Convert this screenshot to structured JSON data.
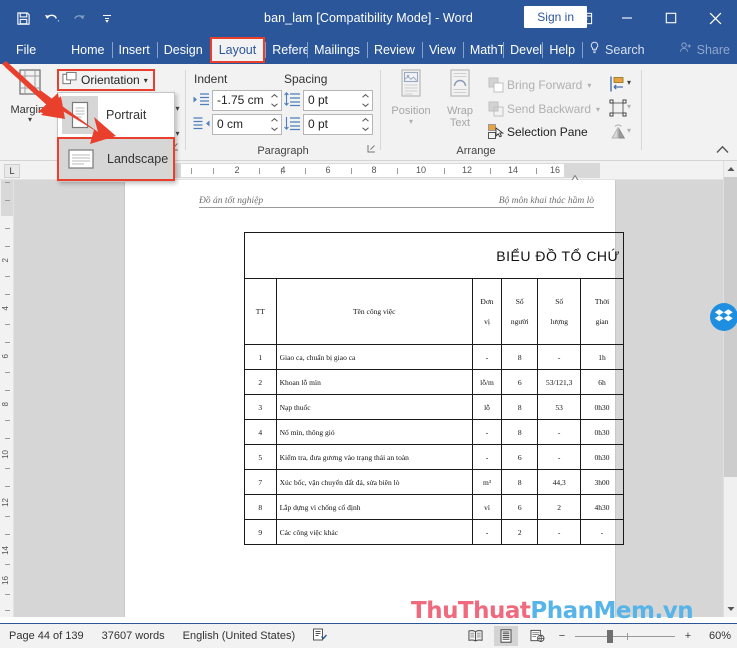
{
  "titlebar": {
    "document_name": "ban_lam [Compatibility Mode]  -  Word",
    "signin_label": "Sign in",
    "qat": [
      {
        "name": "save-icon",
        "tooltip": "Save"
      },
      {
        "name": "undo-icon",
        "tooltip": "Undo"
      },
      {
        "name": "redo-icon",
        "tooltip": "Redo"
      },
      {
        "name": "customize-qat-icon",
        "tooltip": "Customize Quick Access Toolbar"
      }
    ],
    "window_buttons": [
      {
        "name": "ribbon-display-options-icon",
        "glyph": "ribbon"
      },
      {
        "name": "minimize-button",
        "glyph": "minimize"
      },
      {
        "name": "maximize-button",
        "glyph": "maximize"
      },
      {
        "name": "close-button",
        "glyph": "close"
      }
    ]
  },
  "tabs": [
    {
      "label": "File",
      "active": false
    },
    {
      "label": "Home",
      "active": false
    },
    {
      "label": "Insert",
      "active": false
    },
    {
      "label": "Design",
      "active": false
    },
    {
      "label": "Layout",
      "active": true
    },
    {
      "label": "Referenc",
      "active": false
    },
    {
      "label": "Mailings",
      "active": false
    },
    {
      "label": "Review",
      "active": false
    },
    {
      "label": "View",
      "active": false
    },
    {
      "label": "MathTyp",
      "active": false
    },
    {
      "label": "Develop",
      "active": false
    },
    {
      "label": "Help",
      "active": false
    }
  ],
  "tab_extras": {
    "search_label": "Search",
    "share_label": "Share"
  },
  "ribbon": {
    "page_setup": {
      "margins_label": "Margins",
      "orientation_label": "Orientation",
      "group_label": "",
      "dropdown": {
        "open": true,
        "items": [
          {
            "label": "Portrait",
            "selected": false
          },
          {
            "label": "Landscape",
            "selected": true
          }
        ]
      }
    },
    "paragraph": {
      "group_label": "Paragraph",
      "indent_label": "Indent",
      "spacing_label": "Spacing",
      "indent_left_value": "-1.75 cm",
      "indent_right_value": "0 cm",
      "spacing_before_value": "0 pt",
      "spacing_after_value": "0 pt"
    },
    "arrange": {
      "group_label": "Arrange",
      "position_label": "Position",
      "wrap_text_label": "Wrap Text",
      "bring_forward_label": "Bring Forward",
      "send_backward_label": "Send Backward",
      "selection_pane_label": "Selection Pane",
      "align_label": "Align",
      "group_objects_label": "Group",
      "rotate_label": "Rotate"
    }
  },
  "ruler": {
    "horizontal_numbers": [
      "2",
      "4",
      "6",
      "8",
      "10",
      "12",
      "14",
      "16"
    ],
    "vertical_numbers": [
      "2",
      "4",
      "6",
      "8",
      "10",
      "12",
      "14",
      "16"
    ],
    "tab_stop_selector": "L"
  },
  "document": {
    "header_left": "Đồ án tốt nghiệp",
    "header_right": "Bộ môn khai thác hầm lò",
    "table_title": "BIỂU ĐỒ TỔ CHỨ",
    "columns": [
      "TT",
      "Tên công việc",
      "Đơn vị",
      "Số người",
      "Số lượng",
      "Thời gian"
    ],
    "column_lines": {
      "tt": "TT",
      "name": "Tên công việc",
      "donvi_top": "Đơn",
      "donvi_bot": "vị",
      "songuoi_top": "Số",
      "songuoi_bot": "người",
      "soluong_top": "Số",
      "soluong_bot": "lượng",
      "thoigian_top": "Thời",
      "thoigian_bot": "gian"
    },
    "rows": [
      {
        "tt": "1",
        "name": "Giao ca, chuẩn bị giao ca",
        "donvi": "-",
        "songuoi": "8",
        "soluong": "-",
        "thoigian": "1h"
      },
      {
        "tt": "2",
        "name": "Khoan lỗ mìn",
        "donvi": "lỗ/m",
        "songuoi": "6",
        "soluong": "53/121,3",
        "thoigian": "6h"
      },
      {
        "tt": "3",
        "name": "Nạp thuốc",
        "donvi": "lỗ",
        "songuoi": "8",
        "soluong": "53",
        "thoigian": "0h30"
      },
      {
        "tt": "4",
        "name": "Nổ mìn, thông gió",
        "donvi": "-",
        "songuoi": "8",
        "soluong": "-",
        "thoigian": "0h30"
      },
      {
        "tt": "5",
        "name": "Kiểm tra, đưa gương vào trạng thái an toàn",
        "donvi": "-",
        "songuoi": "6",
        "soluong": "-",
        "thoigian": "0h30"
      },
      {
        "tt": "7",
        "name": "Xúc bốc, vận chuyển đất đá, sửa biên lò",
        "donvi": "m³",
        "songuoi": "8",
        "soluong": "44,3",
        "thoigian": "3h00"
      },
      {
        "tt": "8",
        "name": "Lắp dựng vì chống cố định",
        "donvi": "vì",
        "songuoi": "6",
        "soluong": "2",
        "thoigian": "4h30"
      },
      {
        "tt": "9",
        "name": "Các công việc khác",
        "donvi": "-",
        "songuoi": "2",
        "soluong": "-",
        "thoigian": "-"
      }
    ]
  },
  "watermark": {
    "part1": "ThuThuat",
    "part2": "PhanMem.vn"
  },
  "statusbar": {
    "page_info": "Page 44 of 139",
    "word_count": "37607 words",
    "language": "English (United States)",
    "proofing_icon": "proofing-errors-icon",
    "views": [
      {
        "name": "read-mode-view-button",
        "active": false
      },
      {
        "name": "print-layout-view-button",
        "active": true
      },
      {
        "name": "web-layout-view-button",
        "active": false
      }
    ],
    "zoom_level": "60%",
    "zoom_out_label": "−",
    "zoom_in_label": "+"
  },
  "overlay": {
    "dropbox_badge": "dropbox-sync-icon",
    "accent_red": "#e8402c",
    "word_blue": "#2b579a"
  }
}
